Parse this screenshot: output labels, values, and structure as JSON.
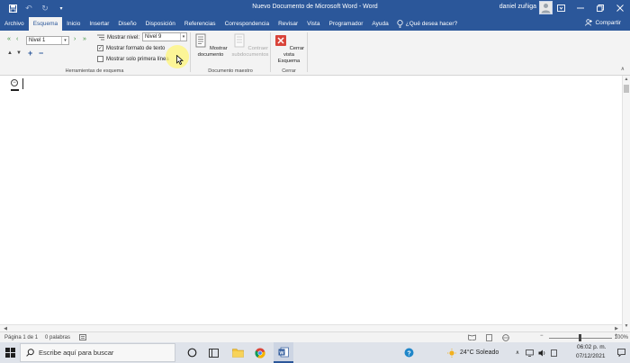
{
  "window": {
    "title": "Nuevo Documento de Microsoft Word  -  Word",
    "user": "daniel zuñiga"
  },
  "tabs": [
    {
      "label": "Archivo",
      "active": false
    },
    {
      "label": "Esquema",
      "active": true
    },
    {
      "label": "Inicio",
      "active": false
    },
    {
      "label": "Insertar",
      "active": false
    },
    {
      "label": "Diseño",
      "active": false
    },
    {
      "label": "Disposición",
      "active": false
    },
    {
      "label": "Referencias",
      "active": false
    },
    {
      "label": "Correspondencia",
      "active": false
    },
    {
      "label": "Revisar",
      "active": false
    },
    {
      "label": "Vista",
      "active": false
    },
    {
      "label": "Programador",
      "active": false
    },
    {
      "label": "Ayuda",
      "active": false
    }
  ],
  "tell_me": "¿Qué desea hacer?",
  "share": "Compartir",
  "ribbon": {
    "outline_tools": {
      "label": "Herramientas de esquema",
      "level_value": "Nivel 1",
      "show_level_label": "Mostrar nivel:",
      "show_level_value": "Nivel 9",
      "show_text_format": "Mostrar formato de texto",
      "show_text_format_checked": true,
      "show_first_line": "Mostrar solo primera línea",
      "show_first_line_checked": false
    },
    "master_document": {
      "label": "Documento maestro",
      "show_document": "Mostrar documento",
      "collapse_subdocuments": "Contraer subdocumentos"
    },
    "close": {
      "label": "Cerrar",
      "close_outline": "Cerrar vista Esquema"
    }
  },
  "status": {
    "page": "Página 1 de 1",
    "words": "0 palabras",
    "zoom": "100%"
  },
  "taskbar": {
    "search_placeholder": "Escribe aquí para buscar",
    "weather": "24°C  Soleado",
    "time": "06:02 p. m.",
    "date": "07/12/2021"
  },
  "colors": {
    "accent": "#2b579a",
    "ribbon_bg": "#f3f3f3",
    "close_red": "#d9443a"
  }
}
